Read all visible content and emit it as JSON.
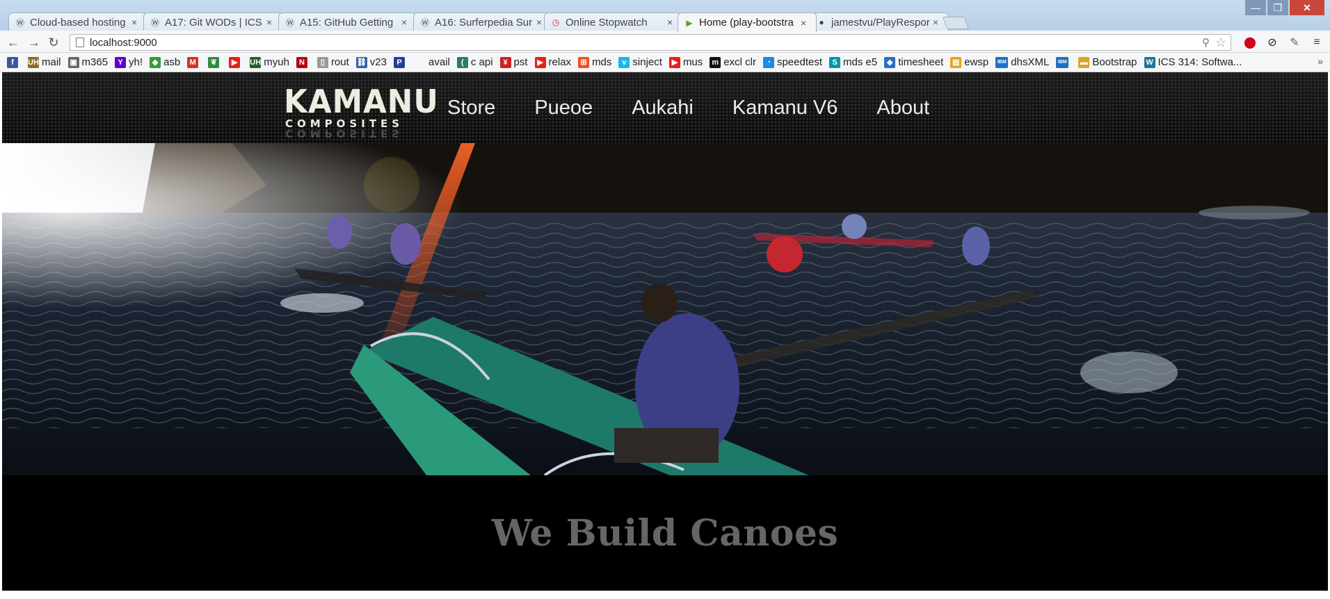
{
  "browser": {
    "tabs": [
      {
        "label": "Cloud-based hosting",
        "icon": "wordpress-icon",
        "active": false
      },
      {
        "label": "A17: Git WODs | ICS",
        "icon": "wordpress-icon",
        "active": false
      },
      {
        "label": "A15: GitHub Getting",
        "icon": "wordpress-icon",
        "active": false
      },
      {
        "label": "A16: Surferpedia Sur",
        "icon": "wordpress-icon",
        "active": false
      },
      {
        "label": "Online Stopwatch",
        "icon": "stopwatch-icon",
        "active": false
      },
      {
        "label": "Home (play-bootstra",
        "icon": "play-icon",
        "active": true
      },
      {
        "label": "jamestvu/PlayRespor",
        "icon": "github-icon",
        "active": false
      }
    ],
    "address": "localhost:9000",
    "bookmarks": [
      {
        "label": "",
        "icon": "facebook-icon",
        "color": "#3b5998",
        "glyph": "f"
      },
      {
        "label": "mail",
        "icon": "uh-icon",
        "color": "#8a6d1f",
        "glyph": "UH"
      },
      {
        "label": "m365",
        "icon": "m365-icon",
        "color": "#666",
        "glyph": "▣"
      },
      {
        "label": "yh!",
        "icon": "yahoo-icon",
        "color": "#5f01d1",
        "glyph": "Y"
      },
      {
        "label": "asb",
        "icon": "asb-icon",
        "color": "#3a9b35",
        "glyph": "◆"
      },
      {
        "label": "",
        "icon": "gmail-icon",
        "color": "#d93025",
        "glyph": "M"
      },
      {
        "label": "",
        "icon": "leaf-icon",
        "color": "#2e8b3a",
        "glyph": "❦"
      },
      {
        "label": "",
        "icon": "youtube-icon",
        "color": "#e62117",
        "glyph": "▶"
      },
      {
        "label": "myuh",
        "icon": "uh-icon",
        "color": "#1f5f2b",
        "glyph": "UH"
      },
      {
        "label": "",
        "icon": "netflix-icon",
        "color": "#b20710",
        "glyph": "N"
      },
      {
        "label": "rout",
        "icon": "page-icon",
        "color": "#999",
        "glyph": "▯"
      },
      {
        "label": "v23",
        "icon": "network-icon",
        "color": "#3465a4",
        "glyph": "⛓"
      },
      {
        "label": "",
        "icon": "pandora-icon",
        "color": "#224099",
        "glyph": "P"
      },
      {
        "label": "avail",
        "icon": "blank-icon",
        "color": "transparent",
        "glyph": ""
      },
      {
        "label": "c api",
        "icon": "c-icon",
        "color": "#2b7a6b",
        "glyph": "("
      },
      {
        "label": "pst",
        "icon": "pst-icon",
        "color": "#d01f1f",
        "glyph": "¥"
      },
      {
        "label": "relax",
        "icon": "youtube-icon",
        "color": "#e62117",
        "glyph": "▶"
      },
      {
        "label": "mds",
        "icon": "windows-icon",
        "color": "#f25022",
        "glyph": "⊞"
      },
      {
        "label": "sinject",
        "icon": "vimeo-icon",
        "color": "#1ab7ea",
        "glyph": "v"
      },
      {
        "label": "mus",
        "icon": "youtube-icon",
        "color": "#e62117",
        "glyph": "▶"
      },
      {
        "label": "excl clr",
        "icon": "m-icon",
        "color": "#111",
        "glyph": "m"
      },
      {
        "label": "speedtest",
        "icon": "speedtest-icon",
        "color": "#1e88e5",
        "glyph": "◔"
      },
      {
        "label": "mds e5",
        "icon": "mds-icon",
        "color": "#0097a7",
        "glyph": "S"
      },
      {
        "label": "timesheet",
        "icon": "timesheet-icon",
        "color": "#2a6ec6",
        "glyph": "◈"
      },
      {
        "label": "ewsp",
        "icon": "ewsp-icon",
        "color": "#e6a316",
        "glyph": "▤"
      },
      {
        "label": "dhsXML",
        "icon": "ibm-icon",
        "color": "#1f70c1",
        "glyph": "IBM"
      },
      {
        "label": "",
        "icon": "ibm-icon",
        "color": "#1f70c1",
        "glyph": "IBM"
      },
      {
        "label": "Bootstrap",
        "icon": "folder-icon",
        "color": "#d9a628",
        "glyph": "▬"
      },
      {
        "label": "ICS 314: Softwa...",
        "icon": "wordpress-icon",
        "color": "#21759b",
        "glyph": "W"
      }
    ]
  },
  "site": {
    "logo_main": "KAMANU",
    "logo_sub": "COMPOSITES",
    "nav": [
      "Store",
      "Pueoe",
      "Aukahi",
      "Kamanu V6",
      "About"
    ],
    "hero_alt": "Outrigger canoe paddlers racing on open ocean",
    "tagline": "We Build Canoes"
  }
}
